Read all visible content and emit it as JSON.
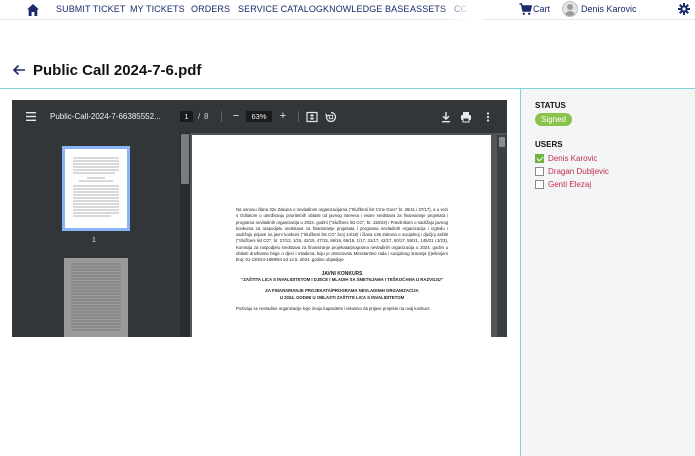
{
  "nav": {
    "items": [
      "SUBMIT TICKET",
      "MY TICKETS",
      "ORDERS",
      "SERVICE CATALOG",
      "KNOWLEDGE BASE",
      "ASSETS",
      "CC"
    ],
    "cart_label": "Cart",
    "user_name": "Denis Karovic",
    "color": "#1b2a6b"
  },
  "page": {
    "title": "Public Call 2024-7-6.pdf"
  },
  "viewer": {
    "file_name": "Public-Call-2024-7-66385552...",
    "current_page": "1",
    "page_separator": "/",
    "total_pages": "8",
    "zoom": "63%",
    "thumbnail_label": "1",
    "document": {
      "intro": "Na osnovu člana 32v Zakona o nevladinim organizacijama (\"Službeni list Crne Gore\" br. 39/11 i 37/17), a u vezi s Odlukom o utvrđivanju prioritetnih oblasti od javnog interesa i visine sredstava za finansiranje projekata i programa nevladinih organizacija u 2024. godini (\"Službeni list CG\", br. 119/23) i Pravilnikom o sadržaju javnog konkursa za raspodjelu sredstava za finansiranje projekata i programa nevladinih organizacija i izgledu i sadržaju prijave na javni konkurs (\"Službeni list CG\" broj 14/18) i člana 136 Zakona o socijalnoj i dječjoj zaštiti (\"Službeni list CG\", br. 27/13, 1/15, 42/15, 47/15, 56/16, 66/16, 1/17, 31/17, 42/17, 50/17, 59/21, 145/21 i 3/23), Komisija za raspodjelu sredstava za finansiranje projekata/programa nevladinih organizacija u 2024. godini u oblasti društvene brige o djeci i mladima, koju je obrazovalo Ministarstvo rada i socijalnog staranja (rješenjem broj: 01-120/24-1889/84 od 14.5. 2024. godine objavljuje",
      "heading": "JAVNI KONKURS",
      "subheading": "\"ZAŠTITA LICA S INVALIDITETOM I DJECE I MLADIH SA SMETNJAMA I TEŠKOĆAMA U RAZVOJU\"",
      "sub2_line1": "ZA FINANSIRANJE PROJEKATA/PROGRAMA NEVLADINIH ORGANIZACIJA",
      "sub2_line2": "U 2024. GODINI U OBLASTI ZAŠTITE LICA S INVALIDITETOM",
      "para2": "Pozivaju se nevladine organizacije koje imaju kapacitete i iskustvo da prijave projekte na ovaj konkurs"
    }
  },
  "sidebar": {
    "status_label": "STATUS",
    "status_value": "Signed",
    "status_color": "#8bc34a",
    "users_label": "USERS",
    "users": [
      {
        "name": "Denis Karovic",
        "checked": true
      },
      {
        "name": "Dragan Dubljevic",
        "checked": false
      },
      {
        "name": "Genti Elezaj",
        "checked": false
      }
    ]
  }
}
